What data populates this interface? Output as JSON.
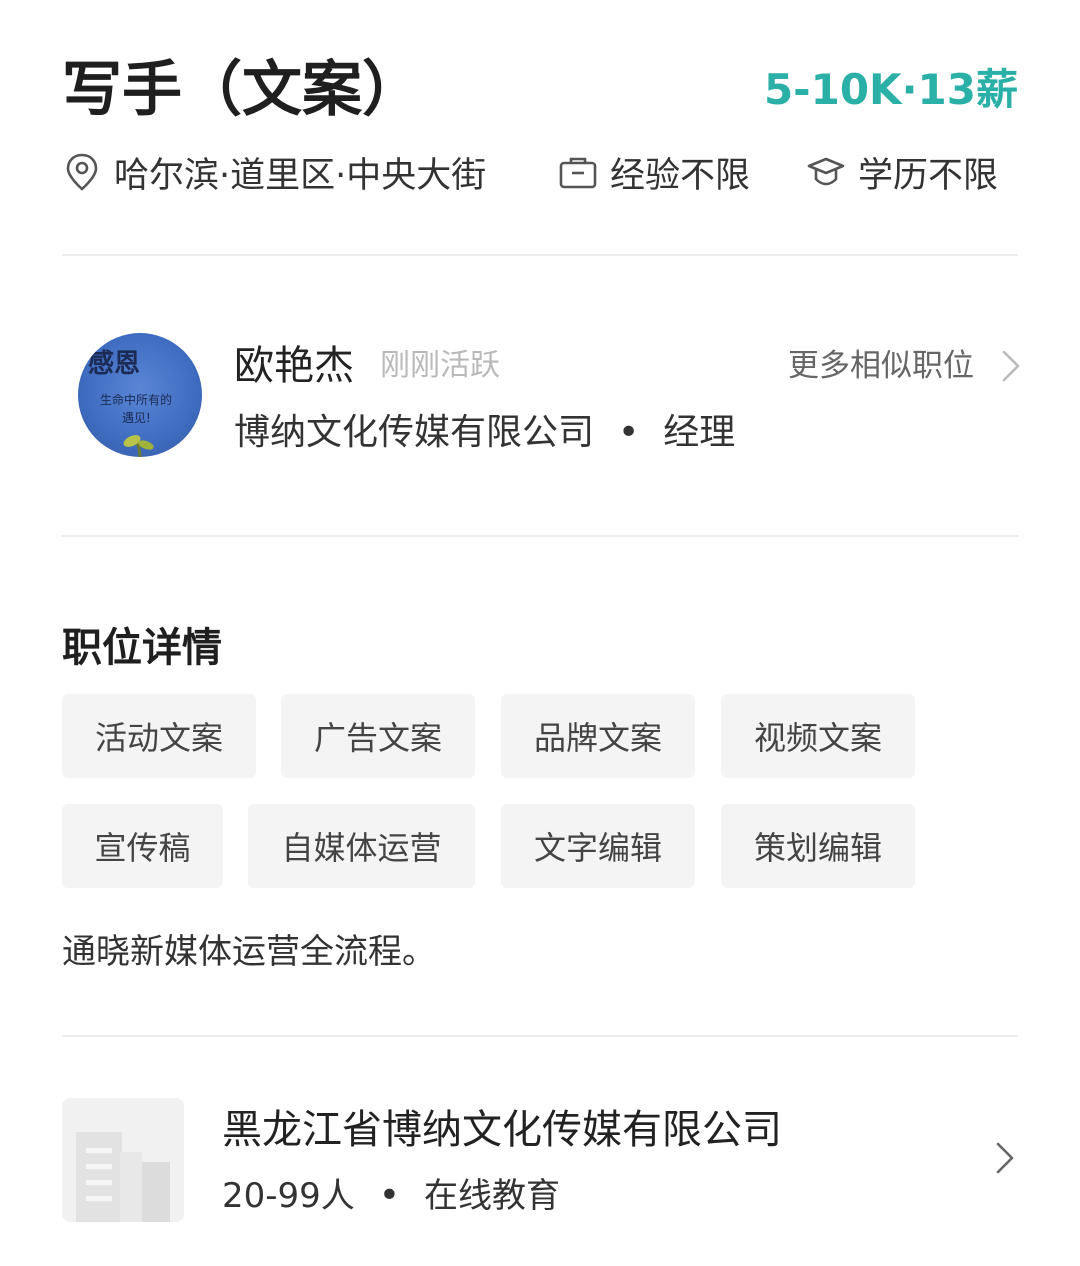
{
  "header": {
    "job_title": "写手（文案）",
    "salary": "5-10K·13薪",
    "location": "哈尔滨·道里区·中央大街",
    "experience": "经验不限",
    "education": "学历不限"
  },
  "recruiter": {
    "name": "欧艳杰",
    "status": "刚刚活跃",
    "more_label": "更多相似职位",
    "company": "博纳文化传媒有限公司",
    "role": "经理",
    "avatar_text": {
      "title": "感恩",
      "line1": "生命中所有的",
      "line2": "遇见!"
    }
  },
  "detail": {
    "title": "职位详情",
    "tags": [
      "活动文案",
      "广告文案",
      "品牌文案",
      "视频文案",
      "宣传稿",
      "自媒体运营",
      "文字编辑",
      "策划编辑"
    ],
    "description": "通晓新媒体运营全流程。"
  },
  "company": {
    "name": "黑龙江省博纳文化传媒有限公司",
    "size": "20-99人",
    "industry": "在线教育"
  },
  "colors": {
    "salary": "#2bb0a8",
    "divider": "#ececec",
    "tag_bg": "#f4f4f4"
  },
  "icons": [
    "location-pin-icon",
    "briefcase-icon",
    "graduation-cap-icon",
    "chevron-right-icon",
    "building-icon"
  ]
}
